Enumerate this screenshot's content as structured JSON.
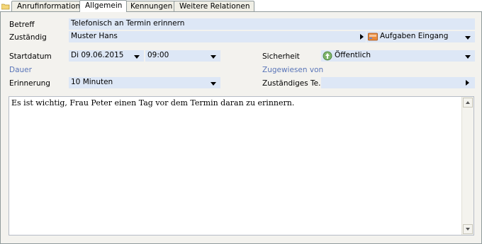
{
  "tabs": [
    {
      "label": "Anrufinformation",
      "active": false
    },
    {
      "label": "Allgemein",
      "active": true
    },
    {
      "label": "Kennungen",
      "active": false
    },
    {
      "label": "Weitere Relationen",
      "active": false
    }
  ],
  "form": {
    "betreff_label": "Betreff",
    "betreff_value": "Telefonisch an Termin erinnern",
    "zustaendig_label": "Zuständig",
    "zustaendig_value": "Muster Hans",
    "aufgaben_value": "Aufgaben Eingang",
    "startdatum_label": "Startdatum",
    "startdatum_value": "Di 09.06.2015",
    "startzeit_value": "09:00",
    "sicherheit_label": "Sicherheit",
    "sicherheit_value": "Öffentlich",
    "dauer_label": "Dauer",
    "zugewiesen_label": "Zugewiesen von",
    "erinnerung_label": "Erinnerung",
    "erinnerung_value": "10 Minuten",
    "zustaendiges_team_label": "Zuständiges Te...",
    "zustaendiges_team_value": ""
  },
  "memo": {
    "text": "Es ist wichtig, Frau Peter einen Tag vor dem Termin daran zu erinnern."
  },
  "colors": {
    "field_bg": "#dde7f6",
    "panel_bg": "#f3f2ee",
    "blue_label": "#5a75b8"
  },
  "icons": {
    "folder": "folder-icon",
    "inbox": "inbox-icon",
    "public": "public-globe-icon"
  }
}
